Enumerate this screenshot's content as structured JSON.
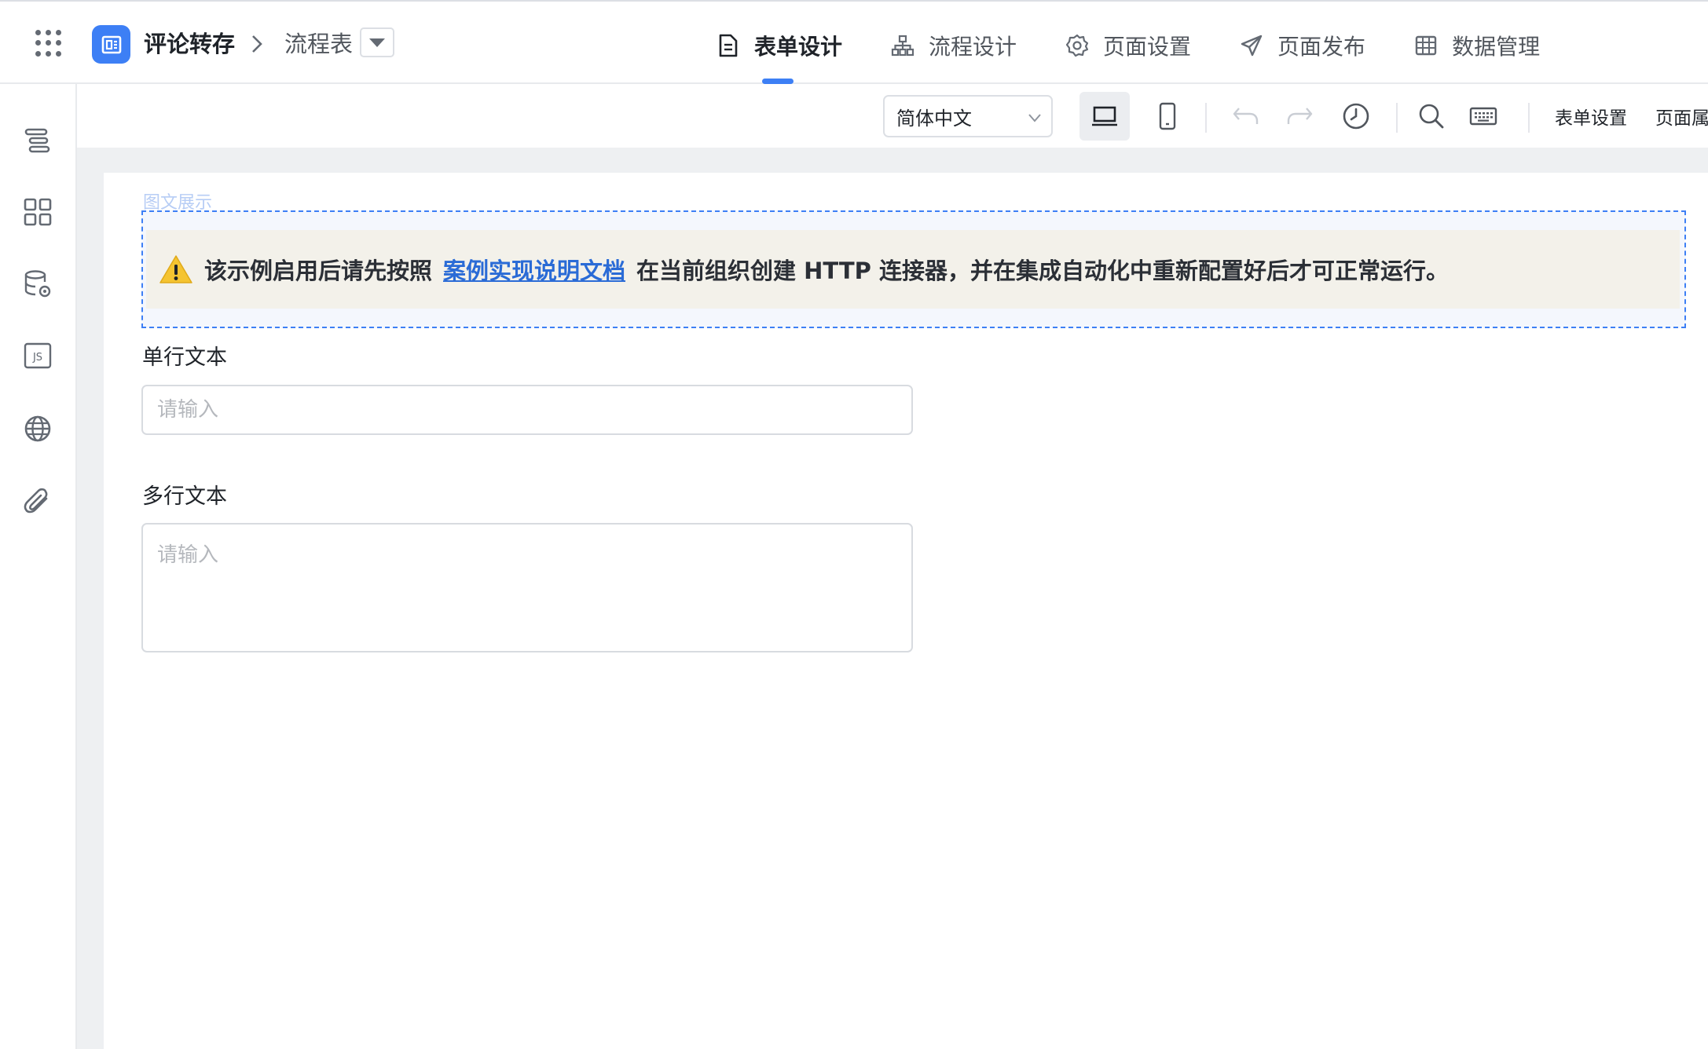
{
  "header": {
    "app_name": "评论转存",
    "page_name": "流程表",
    "tabs": [
      {
        "label": "表单设计",
        "icon": "document-icon",
        "active": true
      },
      {
        "label": "流程设计",
        "icon": "flow-icon"
      },
      {
        "label": "页面设置",
        "icon": "gear-icon"
      },
      {
        "label": "页面发布",
        "icon": "send-icon"
      },
      {
        "label": "数据管理",
        "icon": "table-icon"
      }
    ]
  },
  "rail": {
    "items": [
      "outline-icon",
      "components-icon",
      "datasource-icon",
      "js-icon",
      "globe-icon",
      "attachment-icon"
    ]
  },
  "toolbar": {
    "language": "简体中文",
    "form_settings": "表单设置",
    "page_props": "页面属"
  },
  "canvas": {
    "component_label": "图文展示",
    "notice": {
      "before": "该示例启用后请先按照",
      "link": "案例实现说明文档",
      "after": "在当前组织创建 HTTP 连接器，并在集成自动化中重新配置好后才可正常运行。"
    },
    "fields": [
      {
        "label": "单行文本",
        "placeholder": "请输入"
      },
      {
        "label": "多行文本",
        "placeholder": "请输入"
      }
    ]
  },
  "colors": {
    "accent": "#3d7ff5",
    "link": "#2a6bd6",
    "notice_bg": "#f3f1ea",
    "warning": "#f5c431"
  }
}
